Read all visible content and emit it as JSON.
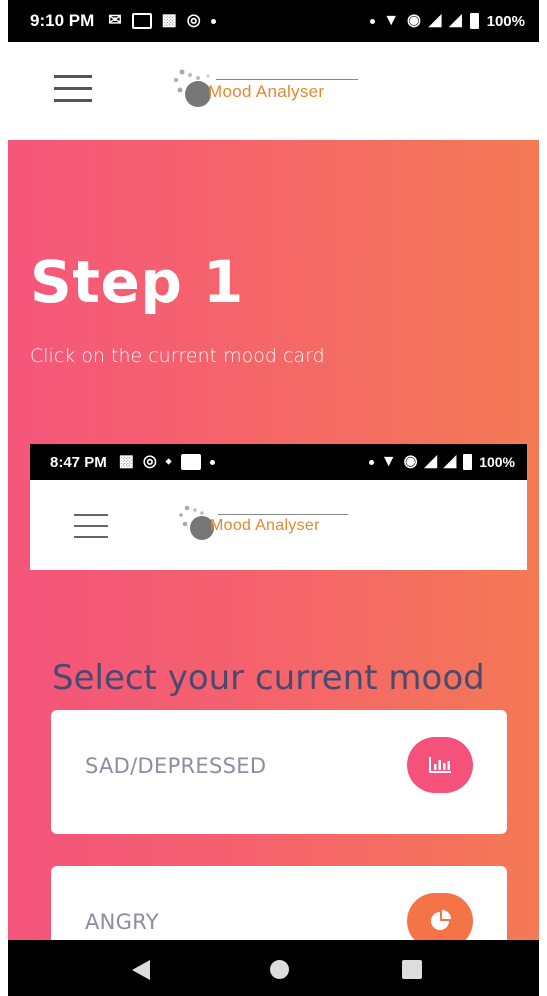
{
  "status_bar": {
    "time": "9:10 PM",
    "battery": "100%"
  },
  "header": {
    "logo_text": "Mood Analyser"
  },
  "hero": {
    "title": "Step 1",
    "subtitle": "Click on the current mood card"
  },
  "nested_screen": {
    "status_bar": {
      "time": "8:47 PM",
      "battery": "100%"
    },
    "header": {
      "logo_text": "Mood Analyser"
    },
    "title": "Select your current mood",
    "cards": [
      {
        "label": "SAD/DEPRESSED",
        "icon": "bar-chart-icon",
        "color": "#f4527a"
      },
      {
        "label": "ANGRY",
        "icon": "pie-chart-icon",
        "color": "#f47448"
      }
    ]
  },
  "colors": {
    "gradient_start": "#f5567b",
    "gradient_end": "#f47a55",
    "title_text": "#4b4a6e",
    "logo_orange": "#e0892f"
  }
}
